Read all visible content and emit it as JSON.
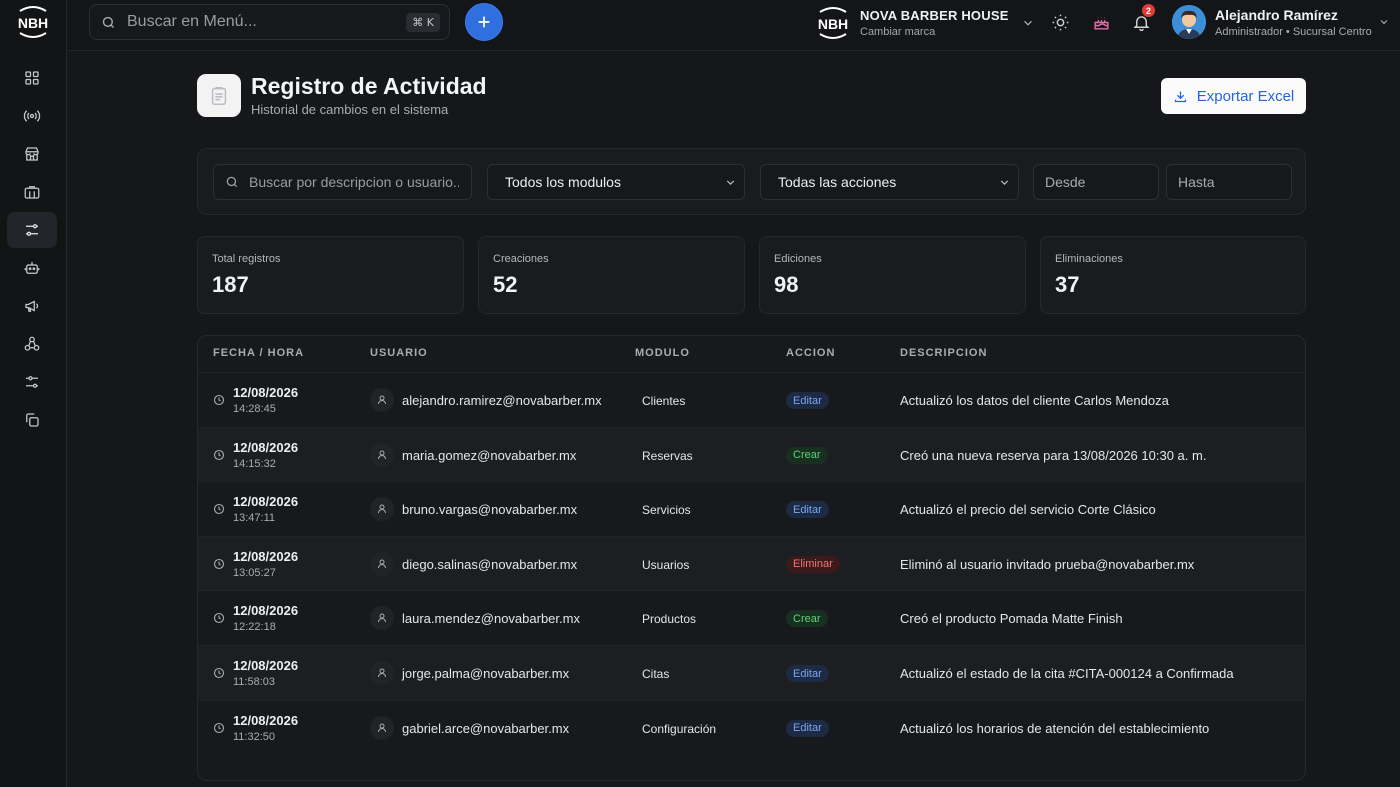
{
  "topbar": {
    "search_placeholder": "Buscar en Menú...",
    "search_shortcut": "⌘ K",
    "brand_name": "NOVA BARBER HOUSE",
    "brand_sub": "Cambiar marca",
    "notification_count": "2",
    "user_name": "Alejandro Ramírez",
    "user_role": "Administrador • Sucursal Centro"
  },
  "logo": {
    "text": "NBH"
  },
  "sidebar": {
    "items": [
      {
        "icon": "dashboard-icon",
        "active": false
      },
      {
        "icon": "broadcast-icon",
        "active": false
      },
      {
        "icon": "store-icon",
        "active": false
      },
      {
        "icon": "briefcase-icon",
        "active": false
      },
      {
        "icon": "sliders-icon",
        "active": true
      },
      {
        "icon": "robot-icon",
        "active": false
      },
      {
        "icon": "megaphone-icon",
        "active": false
      },
      {
        "icon": "network-icon",
        "active": false
      },
      {
        "icon": "settings-sliders-icon",
        "active": false
      },
      {
        "icon": "copy-icon",
        "active": false
      }
    ]
  },
  "header": {
    "title": "Registro de Actividad",
    "subtitle": "Historial de cambios en el sistema",
    "export_label": "Exportar Excel"
  },
  "filters": {
    "search_placeholder": "Buscar por descripcion o usuario...",
    "module_select": "Todos los modulos",
    "action_select": "Todas las acciones",
    "from_placeholder": "Desde",
    "to_placeholder": "Hasta"
  },
  "stats": [
    {
      "label": "Total registros",
      "value": "187"
    },
    {
      "label": "Creaciones",
      "value": "52"
    },
    {
      "label": "Ediciones",
      "value": "98"
    },
    {
      "label": "Eliminaciones",
      "value": "37"
    }
  ],
  "table": {
    "columns": [
      "FECHA / HORA",
      "USUARIO",
      "MODULO",
      "ACCION",
      "DESCRIPCION"
    ],
    "rows": [
      {
        "date": "12/08/2026",
        "time": "14:28:45",
        "user": "alejandro.ramirez@novabarber.mx",
        "module": "Clientes",
        "action": "Editar",
        "type": "edit",
        "description": "Actualizó los datos del cliente Carlos Mendoza"
      },
      {
        "date": "12/08/2026",
        "time": "14:15:32",
        "user": "maria.gomez@novabarber.mx",
        "module": "Reservas",
        "action": "Crear",
        "type": "create",
        "description": "Creó una nueva reserva para 13/08/2026 10:30 a. m."
      },
      {
        "date": "12/08/2026",
        "time": "13:47:11",
        "user": "bruno.vargas@novabarber.mx",
        "module": "Servicios",
        "action": "Editar",
        "type": "edit",
        "description": "Actualizó el precio del servicio Corte Clásico"
      },
      {
        "date": "12/08/2026",
        "time": "13:05:27",
        "user": "diego.salinas@novabarber.mx",
        "module": "Usuarios",
        "action": "Eliminar",
        "type": "delete",
        "description": "Eliminó al usuario invitado prueba@novabarber.mx"
      },
      {
        "date": "12/08/2026",
        "time": "12:22:18",
        "user": "laura.mendez@novabarber.mx",
        "module": "Productos",
        "action": "Crear",
        "type": "create",
        "description": "Creó el producto Pomada Matte Finish"
      },
      {
        "date": "12/08/2026",
        "time": "11:58:03",
        "user": "jorge.palma@novabarber.mx",
        "module": "Citas",
        "action": "Editar",
        "type": "edit",
        "description": "Actualizó el estado de la cita #CITA-000124 a Confirmada"
      },
      {
        "date": "12/08/2026",
        "time": "11:32:50",
        "user": "gabriel.arce@novabarber.mx",
        "module": "Configuración",
        "action": "Editar",
        "type": "edit",
        "description": "Actualizó los horarios de atención del establecimiento"
      }
    ]
  }
}
